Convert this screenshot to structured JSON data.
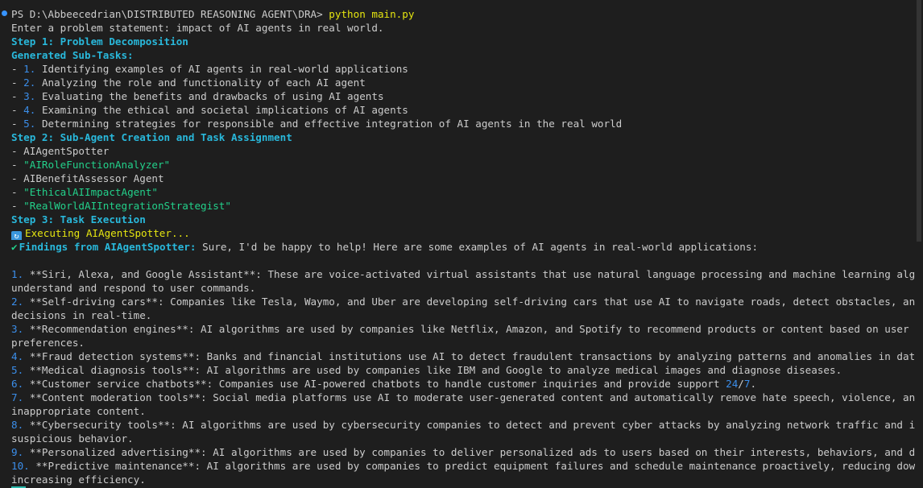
{
  "prompt": {
    "path": "PS D:\\Abbeecedrian\\DISTRIBUTED REASONING AGENT\\DRA>",
    "command": "python main.py"
  },
  "input_line": "Enter a problem statement: impact of AI agents in real world.",
  "step1": {
    "title": "Step 1: Problem Decomposition",
    "subtitle": "Generated Sub-Tasks:",
    "items": [
      {
        "num": "1.",
        "text": "Identifying examples of AI agents in real-world applications"
      },
      {
        "num": "2.",
        "text": "Analyzing the role and functionality of each AI agent"
      },
      {
        "num": "3.",
        "text": "Evaluating the benefits and drawbacks of using AI agents"
      },
      {
        "num": "4.",
        "text": "Examining the ethical and societal implications of AI agents"
      },
      {
        "num": "5.",
        "text": "Determining strategies for responsible and effective integration of AI agents in the real world"
      }
    ]
  },
  "step2": {
    "title": "Step 2: Sub-Agent Creation and Task Assignment",
    "agents": [
      {
        "text": "AIAgentSpotter",
        "quoted": false
      },
      {
        "text": "\"AIRoleFunctionAnalyzer\"",
        "quoted": true
      },
      {
        "text": "AIBenefitAssessor Agent",
        "quoted": false
      },
      {
        "text": "\"EthicalAIImpactAgent\"",
        "quoted": true
      },
      {
        "text": "\"RealWorldAIIntegrationStrategist\"",
        "quoted": true
      }
    ]
  },
  "step3": {
    "title": "Step 3: Task Execution",
    "executing": "Executing AIAgentSpotter...",
    "findings_label": "Findings from AIAgentSpotter:",
    "findings_intro": " Sure, I'd be happy to help! Here are some examples of AI agents in real-world applications:"
  },
  "findings": [
    {
      "num": "1.",
      "lines": [
        " **Siri, Alexa, and Google Assistant**: These are voice-activated virtual assistants that use natural language processing and machine learning algorithms to",
        "understand and respond to user commands."
      ]
    },
    {
      "num": "2.",
      "lines": [
        " **Self-driving cars**: Companies like Tesla, Waymo, and Uber are developing self-driving cars that use AI to navigate roads, detect obstacles, and make",
        "decisions in real-time."
      ]
    },
    {
      "num": "3.",
      "lines": [
        " **Recommendation engines**: AI algorithms are used by companies like Netflix, Amazon, and Spotify to recommend products or content based on user behavior and",
        "preferences."
      ]
    },
    {
      "num": "4.",
      "lines": [
        " **Fraud detection systems**: Banks and financial institutions use AI to detect fraudulent transactions by analyzing patterns and anomalies in data."
      ]
    },
    {
      "num": "5.",
      "lines": [
        " **Medical diagnosis tools**: AI algorithms are used by companies like IBM and Google to analyze medical images and diagnose diseases."
      ]
    },
    {
      "num": "6.",
      "lines": [
        " **Customer service chatbots**: Companies use AI-powered chatbots to handle customer inquiries and provide support "
      ],
      "tail_num": "24",
      "tail_sep": "/",
      "tail_num2": "7",
      "tail_end": "."
    },
    {
      "num": "7.",
      "lines": [
        " **Content moderation tools**: Social media platforms use AI to moderate user-generated content and automatically remove hate speech, violence, and other",
        "inappropriate content."
      ]
    },
    {
      "num": "8.",
      "lines": [
        " **Cybersecurity tools**: AI algorithms are used by cybersecurity companies to detect and prevent cyber attacks by analyzing network traffic and identifying",
        "suspicious behavior."
      ]
    },
    {
      "num": "9.",
      "lines": [
        " **Personalized advertising**: AI algorithms are used by companies to deliver personalized ads to users based on their interests, behaviors, and demographics."
      ]
    },
    {
      "num": "10.",
      "lines": [
        " **Predictive maintenance**: AI algorithms are used by companies to predict equipment failures and schedule maintenance proactively, reducing downtime and",
        "increasing efficiency."
      ]
    }
  ],
  "colors": {
    "background": "#1e1e1e",
    "text": "#cccccc",
    "heading": "#29b8db",
    "number": "#3b8eea",
    "green": "#23d18b",
    "yellow": "#e5e510"
  },
  "icons": {
    "prompt_dot": "circle-dot-icon",
    "executing": "refresh-icon",
    "findings": "checkmark-icon"
  }
}
